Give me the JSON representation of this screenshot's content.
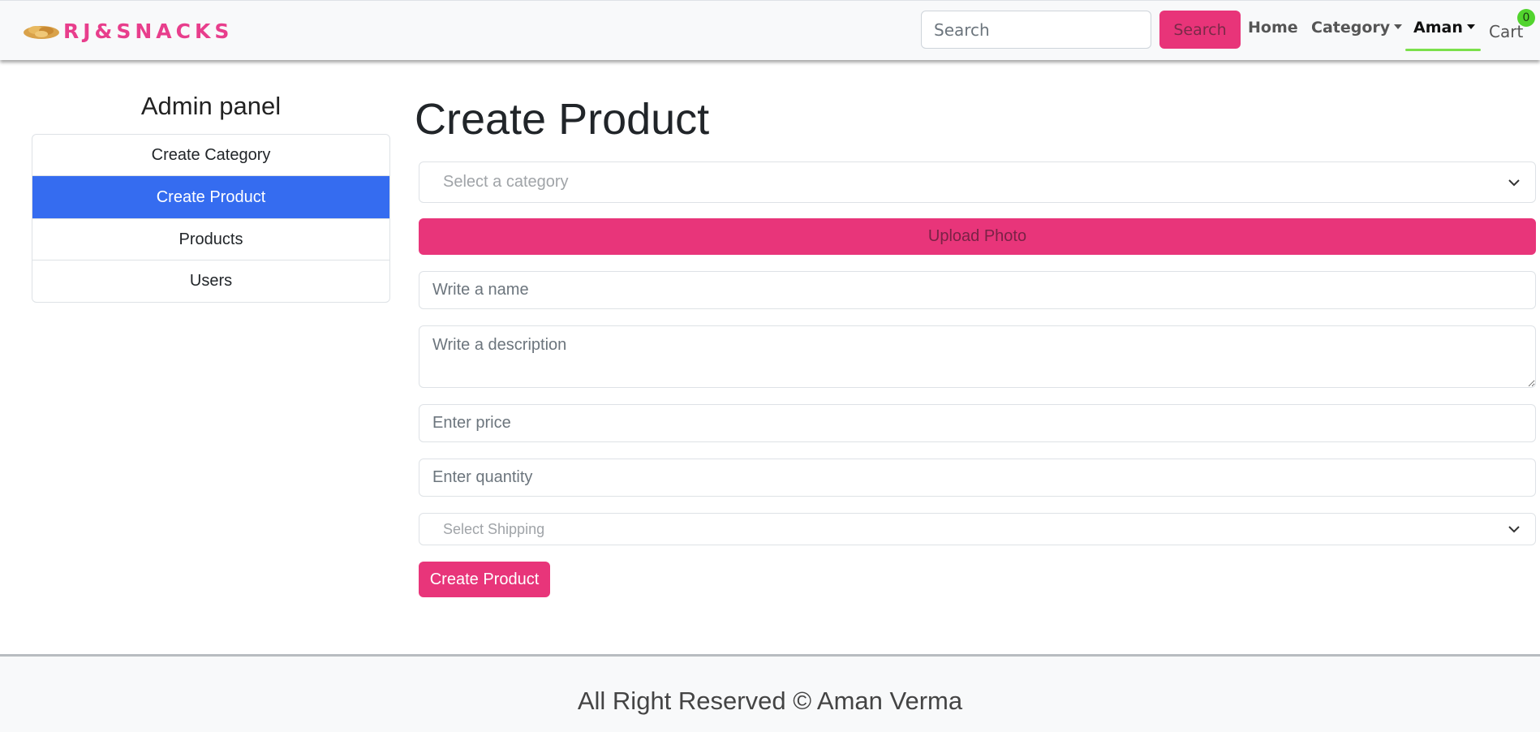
{
  "navbar": {
    "brand": "RJ&SNACKS",
    "search_placeholder": "Search",
    "search_button": "Search",
    "links": {
      "home": "Home",
      "category": "Category",
      "user": "Aman",
      "cart": "Cart"
    },
    "cart_count": "0",
    "icons": {
      "logo": "snack-logo-icon",
      "caret": "caret-down-icon"
    }
  },
  "sidebar": {
    "title": "Admin panel",
    "items": [
      {
        "label": "Create Category",
        "active": false
      },
      {
        "label": "Create Product",
        "active": true
      },
      {
        "label": "Products",
        "active": false
      },
      {
        "label": "Users",
        "active": false
      }
    ]
  },
  "main": {
    "title": "Create Product",
    "category_select_placeholder": "Select a category",
    "upload_button": "Upload Photo",
    "name_placeholder": "Write a name",
    "description_placeholder": "Write a description",
    "price_placeholder": "Enter price",
    "quantity_placeholder": "Enter quantity",
    "shipping_select_placeholder": "Select Shipping",
    "submit_button": "Create Product"
  },
  "footer": {
    "text": "All Right Reserved © Aman Verma"
  },
  "colors": {
    "brand_pink": "#e83479",
    "active_blue": "#356cf0",
    "badge_green": "#52d42e"
  }
}
